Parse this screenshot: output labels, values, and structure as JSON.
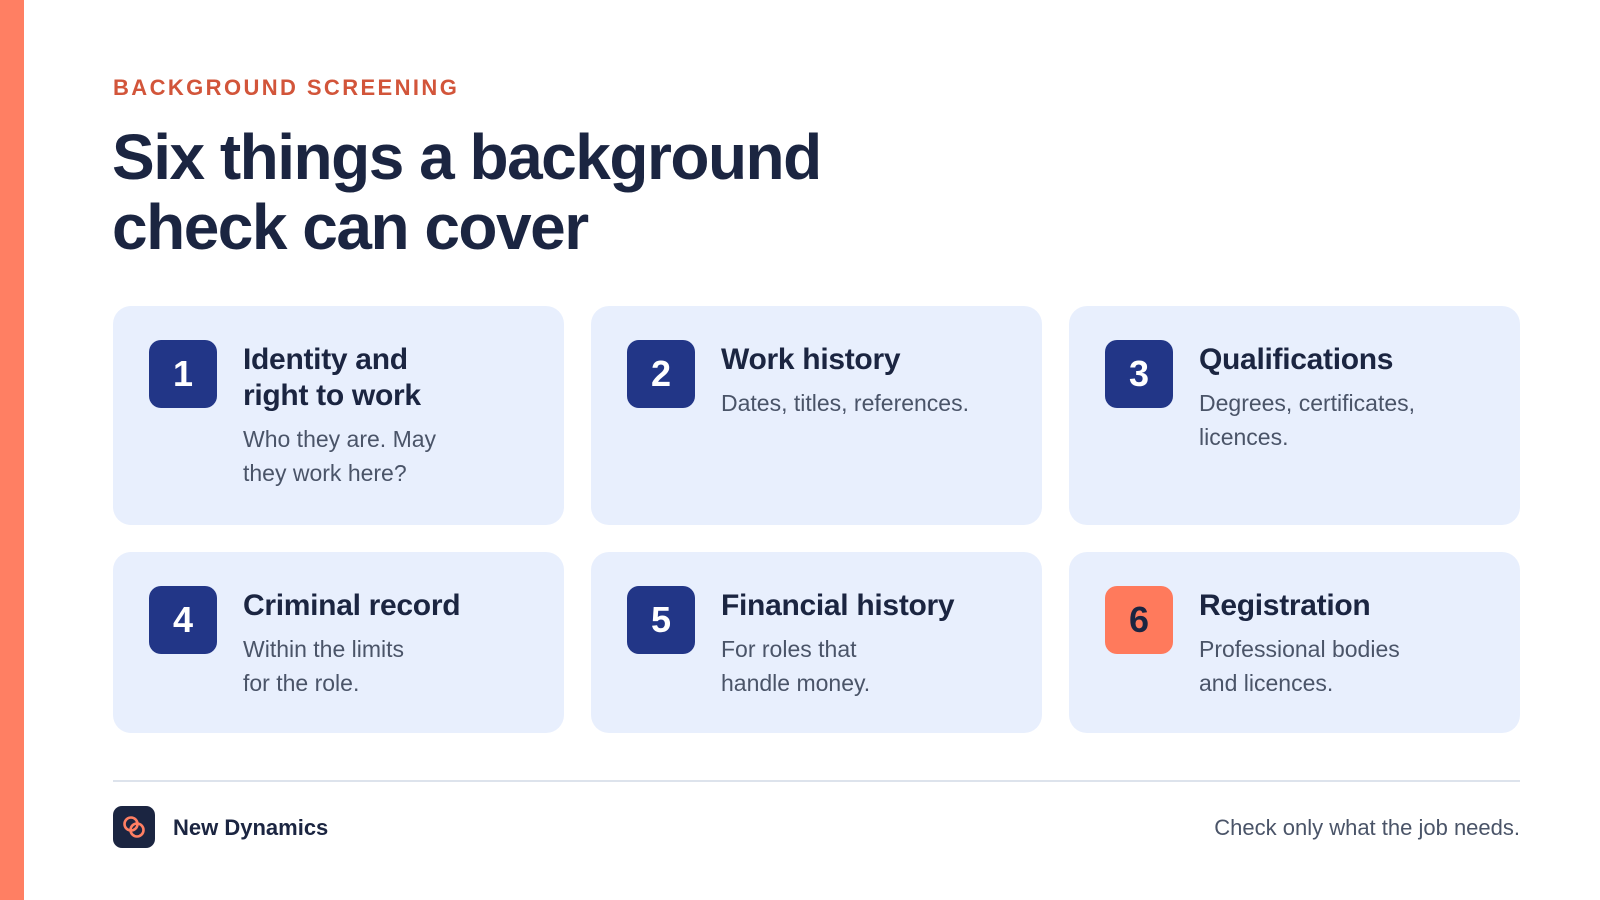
{
  "eyebrow": "BACKGROUND SCREENING",
  "headline": {
    "line1": "Six things a background",
    "line2": "check can cover"
  },
  "cards": [
    {
      "number": "1",
      "title_line1": "Identity and",
      "title_line2": "right to work",
      "desc_line1": "Who they are. May",
      "desc_line2": "they work here?"
    },
    {
      "number": "2",
      "title_line1": "Work history",
      "title_line2": "",
      "desc_line1": "Dates, titles, references.",
      "desc_line2": ""
    },
    {
      "number": "3",
      "title_line1": "Qualifications",
      "title_line2": "",
      "desc_line1": "Degrees, certificates,",
      "desc_line2": "licences."
    },
    {
      "number": "4",
      "title_line1": "Criminal record",
      "title_line2": "",
      "desc_line1": "Within the limits",
      "desc_line2": "for the role."
    },
    {
      "number": "5",
      "title_line1": "Financial history",
      "title_line2": "",
      "desc_line1": "For roles that",
      "desc_line2": "handle money."
    },
    {
      "number": "6",
      "title_line1": "Registration",
      "title_line2": "",
      "desc_line1": "Professional bodies",
      "desc_line2": "and licences."
    }
  ],
  "footer": {
    "brand": "New Dynamics",
    "logo_icon": "interlocking-rings-icon",
    "tagline": "Check only what the job needs."
  },
  "colors": {
    "accent": "#FF7F63",
    "eyebrow": "#D2553A",
    "navy": "#1B2541",
    "badge": "#223687",
    "card_bg": "#E8EFFD",
    "highlight_badge": "#FF7A5C"
  }
}
